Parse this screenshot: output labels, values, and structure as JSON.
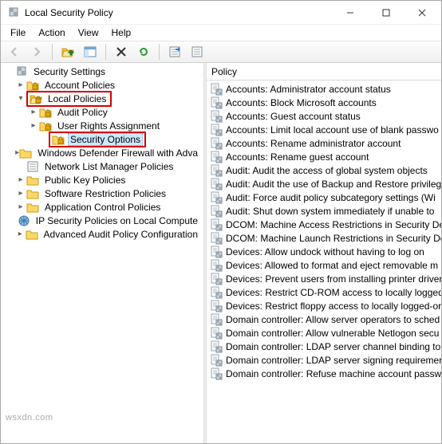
{
  "window": {
    "title": "Local Security Policy"
  },
  "menu": {
    "file": "File",
    "action": "Action",
    "view": "View",
    "help": "Help"
  },
  "left": {
    "root": "Security Settings",
    "account_policies": "Account Policies",
    "local_policies": "Local Policies",
    "audit_policy": "Audit Policy",
    "user_rights": "User Rights Assignment",
    "security_options": "Security Options",
    "firewall": "Windows Defender Firewall with Adva",
    "nlm": "Network List Manager Policies",
    "pkp": "Public Key Policies",
    "srp": "Software Restriction Policies",
    "acp": "Application Control Policies",
    "ipsec": "IP Security Policies on Local Compute",
    "aapc": "Advanced Audit Policy Configuration"
  },
  "right": {
    "header": "Policy",
    "items": [
      "Accounts: Administrator account status",
      "Accounts: Block Microsoft accounts",
      "Accounts: Guest account status",
      "Accounts: Limit local account use of blank passwo",
      "Accounts: Rename administrator account",
      "Accounts: Rename guest account",
      "Audit: Audit the access of global system objects",
      "Audit: Audit the use of Backup and Restore privileg",
      "Audit: Force audit policy subcategory settings (Wi",
      "Audit: Shut down system immediately if unable to",
      "DCOM: Machine Access Restrictions in Security De",
      "DCOM: Machine Launch Restrictions in Security De",
      "Devices: Allow undock without having to log on",
      "Devices: Allowed to format and eject removable m",
      "Devices: Prevent users from installing printer driver",
      "Devices: Restrict CD-ROM access to locally logged-",
      "Devices: Restrict floppy access to locally logged-or",
      "Domain controller: Allow server operators to sched",
      "Domain controller: Allow vulnerable Netlogon secu",
      "Domain controller: LDAP server channel binding to",
      "Domain controller: LDAP server signing requiremer",
      "Domain controller: Refuse machine account passw"
    ]
  },
  "watermark": "wsxdn.com"
}
